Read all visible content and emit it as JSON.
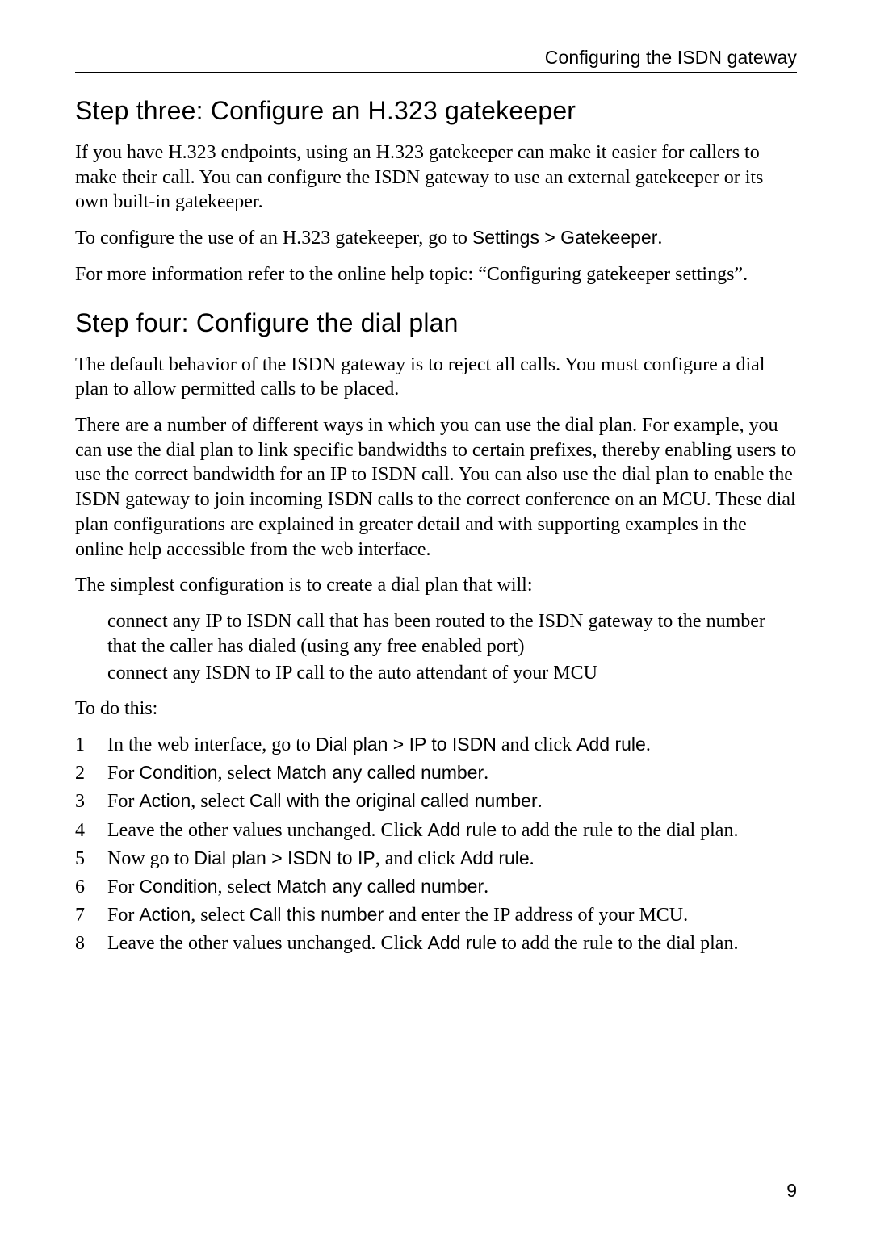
{
  "header": "Configuring the ISDN gateway",
  "page_number": "9",
  "sections": {
    "step3": {
      "title": "Step three: Configure an H.323 gatekeeper",
      "p1": "If you have H.323 endpoints, using an H.323 gatekeeper can make it easier for callers to make their call. You can configure the ISDN gateway to use an external gatekeeper or its own built-in gatekeeper.",
      "p2_pre": "To configure the use of an H.323 gatekeeper, go to ",
      "p2_ui": "Settings > Gatekeeper",
      "p2_post": ".",
      "p3": "For more information refer to the online help topic: “Configuring gatekeeper settings”."
    },
    "step4": {
      "title": "Step four: Configure the dial plan",
      "p1": "The default behavior of the ISDN gateway is to reject all calls. You must configure a dial plan to allow permitted calls to be placed.",
      "p2": "There are a number of different ways in which you can use the dial plan. For example, you can use the dial plan to link specific bandwidths to certain prefixes, thereby enabling users to use the correct bandwidth for an IP to ISDN call. You can also use the dial plan to enable the ISDN gateway to join incoming ISDN calls to the correct conference on an MCU. These dial plan configurations are explained in greater detail and with supporting examples in the online help accessible from the web interface.",
      "p3": "The simplest configuration is to create a dial plan that will:",
      "bullets": {
        "b1": "connect any IP to ISDN call that has been routed to the ISDN gateway to the number that the caller has dialed (using any free enabled port)",
        "b2": "connect any ISDN to IP call to the auto attendant of your MCU"
      },
      "p4": "To do this:",
      "steps": {
        "s1_a": "In the web interface, go to ",
        "s1_ui1": "Dial plan > IP to ISDN",
        "s1_b": " and click ",
        "s1_ui2": "Add rule",
        "s1_c": ".",
        "s2_a": "For ",
        "s2_ui1": "Condition",
        "s2_b": ", select ",
        "s2_ui2": "Match any called number",
        "s2_c": ".",
        "s3_a": "For ",
        "s3_ui1": "Action",
        "s3_b": ", select ",
        "s3_ui2": "Call with the original called number",
        "s3_c": ".",
        "s4_a": "Leave the other values unchanged. Click ",
        "s4_ui1": "Add rule",
        "s4_b": " to add the rule to the dial plan.",
        "s5_a": "Now go to ",
        "s5_ui1": "Dial plan > ISDN to IP",
        "s5_b": ", and click ",
        "s5_ui2": "Add rule",
        "s5_c": ".",
        "s6_a": "For ",
        "s6_ui1": "Condition",
        "s6_b": ", select ",
        "s6_ui2": "Match any called number",
        "s6_c": ".",
        "s7_a": "For ",
        "s7_ui1": "Action",
        "s7_b": ", select ",
        "s7_ui2": "Call this number",
        "s7_c": " and enter the IP address of your MCU.",
        "s8_a": "Leave the other values unchanged. Click ",
        "s8_ui1": "Add rule",
        "s8_b": " to add the rule to the dial plan."
      }
    }
  }
}
